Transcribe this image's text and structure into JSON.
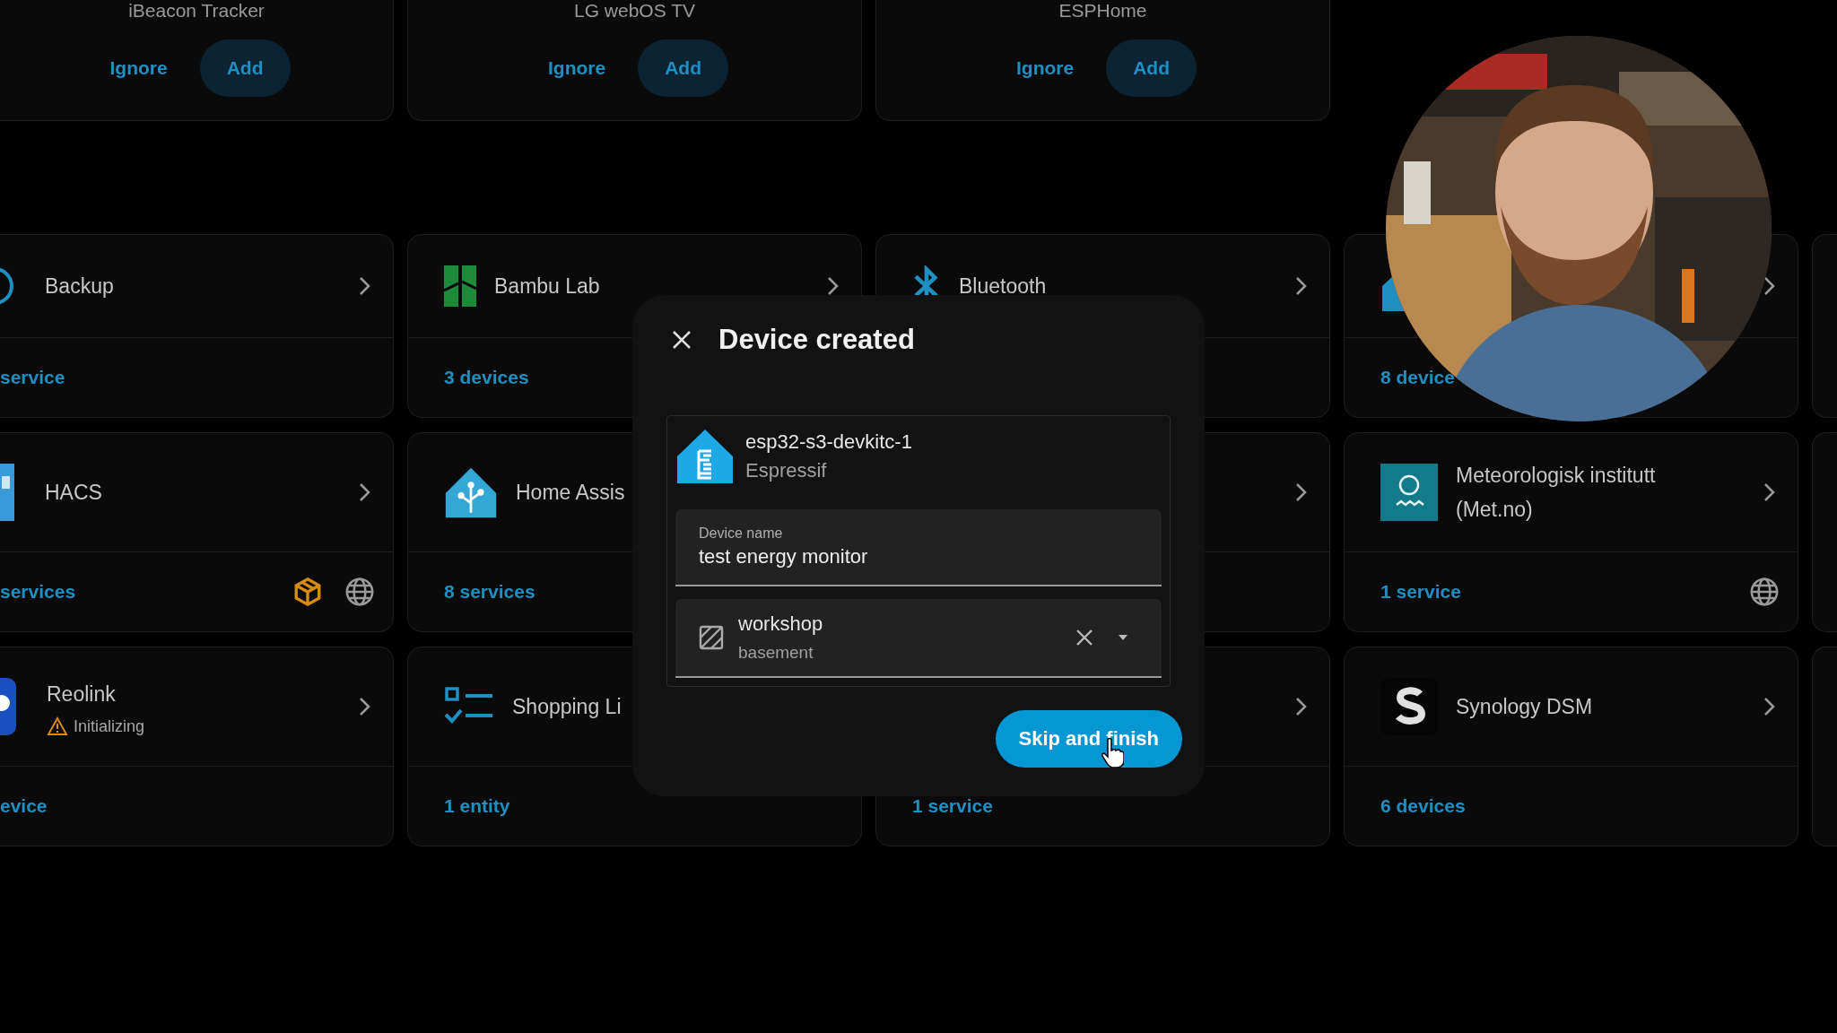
{
  "discovered": [
    {
      "title": "iBeacon Tracker",
      "ignore": "Ignore",
      "add": "Add"
    },
    {
      "title": "LG webOS TV",
      "ignore": "Ignore",
      "add": "Add"
    },
    {
      "title": "ESPHome",
      "ignore": "Ignore",
      "add": "Add"
    }
  ],
  "integration_rows": [
    [
      {
        "kind": "integration",
        "title": "Backup",
        "footer": "service",
        "arrow": true
      },
      {
        "kind": "integration",
        "title": "Bambu Lab",
        "footer": "3 devices",
        "arrow": true
      },
      {
        "kind": "integration",
        "title": "Bluetooth",
        "arrow": true
      },
      {
        "kind": "integration",
        "footer": "8 device",
        "arrow": true
      }
    ],
    [
      {
        "kind": "integration",
        "title": "HACS",
        "footer": "services",
        "arrow": true
      },
      {
        "kind": "integration",
        "title": "Home Assis",
        "footer": "8 services",
        "arrow": false
      },
      {
        "kind": "integration",
        "arrow": true
      },
      {
        "kind": "integration",
        "title": "Meteorologisk institutt (Met.no)",
        "footer": "1 service",
        "arrow": true
      }
    ],
    [
      {
        "kind": "integration",
        "title": "Reolink",
        "status": "Initializing",
        "footer": "evice",
        "arrow": true
      },
      {
        "kind": "integration",
        "title": "Shopping Li",
        "footer": "1 entity",
        "arrow": false
      },
      {
        "kind": "integration",
        "footer": "1 service",
        "arrow": true
      },
      {
        "kind": "integration",
        "title": "Synology DSM",
        "footer": "6 devices",
        "arrow": true
      }
    ]
  ],
  "dialog": {
    "title": "Device created",
    "device": {
      "name": "esp32-s3-devkitc-1",
      "maker": "Espressif"
    },
    "name_field": {
      "label": "Device name",
      "value": "test energy monitor"
    },
    "area": {
      "name": "workshop",
      "floor": "basement"
    },
    "button": "Skip and finish"
  }
}
